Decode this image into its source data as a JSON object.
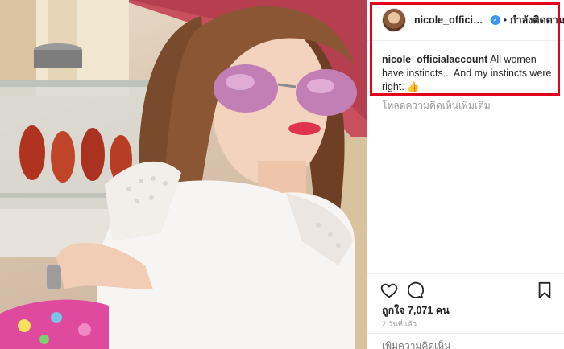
{
  "post": {
    "username": "nicole_officialacc...",
    "verified_badge": "✓",
    "separator": "•",
    "follow_label": "กำลังติดตาม",
    "caption_user": "nicole_officialaccount",
    "caption_text": "All women have instincts... And my instincts were right. 👍",
    "load_more_label": "โหลดความคิดเห็นเพิ่มเติม",
    "likes_label": "ถูกใจ 7,071 คน",
    "time_label": "2 วันที่แล้ว",
    "add_comment_placeholder": "เพิ่มความคิดเห็น"
  },
  "icons": {
    "like": "heart-icon",
    "comment": "comment-bubble-icon",
    "save": "bookmark-icon",
    "verified": "verified-badge-icon"
  },
  "colors": {
    "verified_blue": "#3897f0",
    "highlight_red": "#e3001b",
    "muted_text": "#999999"
  }
}
